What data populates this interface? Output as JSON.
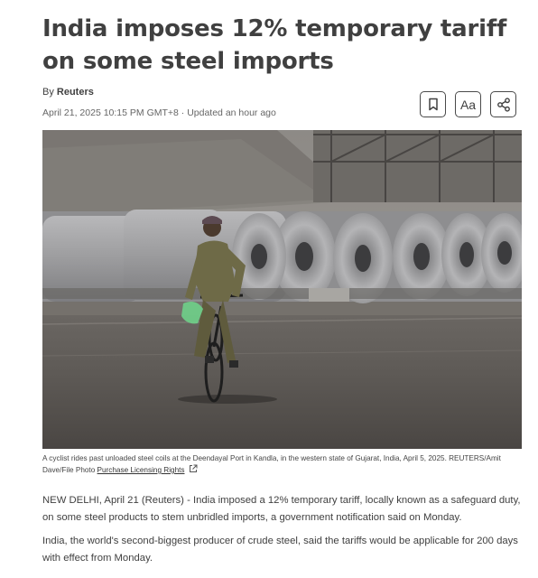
{
  "article": {
    "headline": "India imposes 12% temporary tariff on some steel imports",
    "byline_prefix": "By",
    "author": "Reuters",
    "dateline": "April 21, 2025 10:15 PM GMT+8 · Updated an hour ago"
  },
  "toolbar": {
    "bookmark_icon": "bookmark-icon",
    "text_size_label": "Aa",
    "share_icon": "share-icon"
  },
  "photo": {
    "caption": "A cyclist rides past unloaded steel coils at the Deendayal Port in Kandla, in the western state of Gujarat, India, April 5, 2025. REUTERS/Amit Dave/File Photo",
    "license_link": "Purchase Licensing Rights",
    "license_icon": "external-link-icon"
  },
  "body": {
    "paragraphs": [
      "NEW DELHI, April 21 (Reuters) - India imposed a 12% temporary tariff, locally known as a safeguard duty, on some steel products to stem unbridled imports, a government notification said on Monday.",
      "India, the world's second-biggest producer of crude steel, said the tariffs would be applicable for 200 days with effect from Monday."
    ]
  }
}
